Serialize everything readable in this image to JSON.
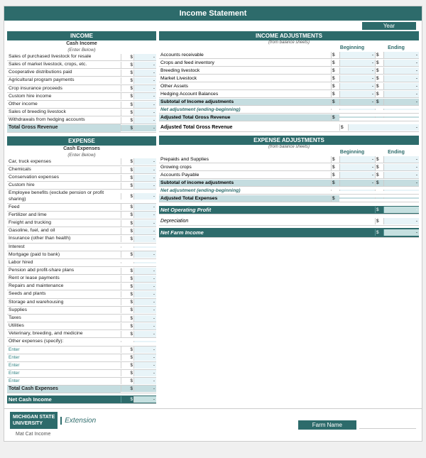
{
  "title": "Income Statement",
  "year_label": "Year",
  "income": {
    "section_title": "INCOME",
    "sub_title": "Cash Income",
    "enter_below": "(Enter Below)",
    "rows": [
      {
        "label": "Sales of purchased livestock for resale",
        "dollar": "$",
        "value": "-"
      },
      {
        "label": "Sales of market livestock, crops, etc.",
        "dollar": "$",
        "value": "-"
      },
      {
        "label": "Cooperative distributions paid",
        "dollar": "$",
        "value": "-"
      },
      {
        "label": "Agricultural program payments",
        "dollar": "$",
        "value": "-"
      },
      {
        "label": "Crop insurance proceeds",
        "dollar": "$",
        "value": "-"
      },
      {
        "label": "Custom hire income",
        "dollar": "$",
        "value": "-"
      },
      {
        "label": "Other income",
        "dollar": "$",
        "value": "-"
      },
      {
        "label": "Sales of breeding livestock",
        "dollar": "$",
        "value": "-"
      },
      {
        "label": "Withdrawals from hedging accounts",
        "dollar": "$",
        "value": "-"
      },
      {
        "label": "Total Gross Revenue",
        "dollar": "$",
        "value": "-",
        "total": true
      }
    ]
  },
  "expense": {
    "section_title": "EXPENSE",
    "sub_title": "Cash Expenses",
    "enter_below": "(Enter Below)",
    "rows": [
      {
        "label": "Car, truck expenses",
        "dollar": "$",
        "value": "-"
      },
      {
        "label": "Chemicals",
        "dollar": "$",
        "value": "-"
      },
      {
        "label": "Conservation expenses",
        "dollar": "$",
        "value": "-"
      },
      {
        "label": "Custom hire",
        "dollar": "$",
        "value": "-"
      },
      {
        "label": "Employee benefits (exclude pension or profit sharing)",
        "dollar": "$",
        "value": "-"
      },
      {
        "label": "Feed",
        "dollar": "$",
        "value": "-"
      },
      {
        "label": "Fertilizer and lime",
        "dollar": "$",
        "value": "-"
      },
      {
        "label": "Freight and trucking",
        "dollar": "$",
        "value": "-"
      },
      {
        "label": "Gasoline, fuel, and oil",
        "dollar": "$",
        "value": "-"
      },
      {
        "label": "Insurance (other than health)",
        "dollar": "$",
        "value": "-"
      },
      {
        "label": "Interest",
        "dollar": "$",
        "value": "-"
      },
      {
        "label": "Mortgage (paid to bank)",
        "dollar": "$",
        "value": "-"
      },
      {
        "label": "Labor hired",
        "dollar": "$",
        "value": "-"
      },
      {
        "label": "Pension abd profit-share plans",
        "dollar": "$",
        "value": "-"
      },
      {
        "label": "Rent or lease payments",
        "dollar": "$",
        "value": "-"
      },
      {
        "label": "Repairs and maintenance",
        "dollar": "$",
        "value": "-"
      },
      {
        "label": "Seeds and plants",
        "dollar": "$",
        "value": "-"
      },
      {
        "label": "Storage and warehousing",
        "dollar": "$",
        "value": "-"
      },
      {
        "label": "Supplies",
        "dollar": "$",
        "value": "-"
      },
      {
        "label": "Taxes",
        "dollar": "$",
        "value": "-"
      },
      {
        "label": "Utilities",
        "dollar": "$",
        "value": "-"
      },
      {
        "label": "Veterinary, breeding, and medicine",
        "dollar": "$",
        "value": "-"
      },
      {
        "label": "Other expenses (specify):",
        "dollar": "",
        "value": ""
      },
      {
        "label": "Enter",
        "dollar": "$",
        "value": "-",
        "enter": true
      },
      {
        "label": "Enter",
        "dollar": "$",
        "value": "-",
        "enter": true
      },
      {
        "label": "Enter",
        "dollar": "$",
        "value": "-",
        "enter": true
      },
      {
        "label": "Enter",
        "dollar": "$",
        "value": "-",
        "enter": true
      },
      {
        "label": "Enter",
        "dollar": "$",
        "value": "-",
        "enter": true
      },
      {
        "label": "Total Cash Expenses",
        "dollar": "$",
        "value": "-",
        "total": true
      }
    ],
    "net_cash": {
      "label": "Net Cash Income",
      "dollar": "$",
      "value": "-"
    }
  },
  "income_adjustments": {
    "section_title": "INCOME ADJUSTMENTS",
    "from_balance": "(from balance sheets)",
    "beginning": "Beginning",
    "ending": "Ending",
    "rows": [
      {
        "label": "Accounts receivable",
        "d1": "$",
        "v1": "-",
        "d2": "$",
        "v2": "-"
      },
      {
        "label": "Crops and feed inventory",
        "d1": "$",
        "v1": "-",
        "d2": "$",
        "v2": "-"
      },
      {
        "label": "Breeding livestock",
        "d1": "$",
        "v1": "-",
        "d2": "$",
        "v2": "-"
      },
      {
        "label": "Market Livestock",
        "d1": "$",
        "v1": "-",
        "d2": "$",
        "v2": "-"
      },
      {
        "label": "Other Assets",
        "d1": "$",
        "v1": "-",
        "d2": "$",
        "v2": "-"
      },
      {
        "label": "Hedging Account Balances",
        "d1": "$",
        "v1": "-",
        "d2": "$",
        "v2": "-"
      },
      {
        "label": "Subtotal of Income adjustments",
        "d1": "$",
        "v1": "-",
        "d2": "$",
        "v2": "-",
        "shaded": true
      },
      {
        "label": "Net adjustment (ending-beginning)",
        "d1": "",
        "v1": "",
        "d2": "",
        "v2": "",
        "green": true
      },
      {
        "label": "Adjusted Total Gross Revenue",
        "d1": "$",
        "v1": "",
        "d2": "",
        "v2": "",
        "shaded": true,
        "bold": true
      }
    ],
    "adj_total_gross": {
      "label": "Adjusted Total Gross Revenue",
      "dollar": "$",
      "value": "-"
    }
  },
  "expense_adjustments": {
    "section_title": "EXPENSE ADJUSTMENTS",
    "from_balance": "(from balance sheets)",
    "beginning": "Beginning",
    "ending": "Ending",
    "rows": [
      {
        "label": "Prepaids and Supplies",
        "d1": "$",
        "v1": "-",
        "d2": "$",
        "v2": "-"
      },
      {
        "label": "Growing crops",
        "d1": "$",
        "v1": "-",
        "d2": "$",
        "v2": "-"
      },
      {
        "label": "Accounts Payable",
        "d1": "$",
        "v1": "-",
        "d2": "$",
        "v2": "-"
      },
      {
        "label": "Subtotal of income adjustments",
        "d1": "$",
        "v1": "-",
        "d2": "$",
        "v2": "-",
        "shaded": true
      },
      {
        "label": "Net adjustment (ending-beginning)",
        "d1": "",
        "v1": "",
        "d2": "",
        "v2": "",
        "green": true
      },
      {
        "label": "Adjusted Total Expenses",
        "d1": "$",
        "v1": "",
        "d2": "",
        "v2": "",
        "shaded": true,
        "bold": true
      }
    ]
  },
  "net_operating": {
    "label": "Net Operating Profit",
    "dollar": "$",
    "value": "-"
  },
  "depreciation": {
    "label": "Depreciation",
    "dollar": "$",
    "value": "-"
  },
  "net_farm_income": {
    "label": "Net Farm Income",
    "dollar": "$",
    "value": "-"
  },
  "footer": {
    "msu_line1": "MICHIGAN STATE",
    "msu_line2": "UNIVERSITY",
    "extension": "Extension",
    "mat_cat": "Mat Cat Income",
    "farm_name_label": "Farm Name"
  }
}
